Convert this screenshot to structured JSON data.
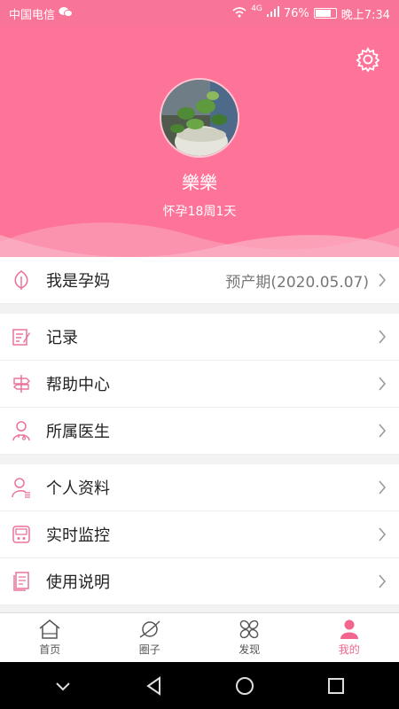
{
  "status_bar": {
    "carrier": "中国电信",
    "network": "4G",
    "battery": "76%",
    "time": "晚上7:34"
  },
  "profile": {
    "nickname": "樂樂",
    "pregnancy_status": "怀孕18周1天"
  },
  "menu": {
    "pregnant": {
      "label": "我是孕妈",
      "value": "预产期(2020.05.07)"
    },
    "records": {
      "label": "记录"
    },
    "help": {
      "label": "帮助中心"
    },
    "doctor": {
      "label": "所属医生"
    },
    "personal_info": {
      "label": "个人资料"
    },
    "monitoring": {
      "label": "实时监控"
    },
    "manual": {
      "label": "使用说明"
    }
  },
  "tabs": [
    {
      "label": "首页",
      "icon": "home-icon",
      "active": false
    },
    {
      "label": "圈子",
      "icon": "planet-icon",
      "active": false
    },
    {
      "label": "发现",
      "icon": "discover-icon",
      "active": false
    },
    {
      "label": "我的",
      "icon": "user-icon",
      "active": true
    }
  ],
  "colors": {
    "header": "#fe7498",
    "accent": "#f2668d",
    "icon": "#e8739a"
  }
}
